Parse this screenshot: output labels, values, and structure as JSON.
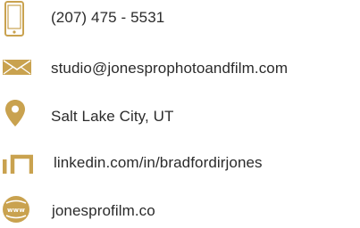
{
  "accent_color": "#c9a24f",
  "contacts": [
    {
      "icon": "phone-icon",
      "text": "(207) 475 - 5531"
    },
    {
      "icon": "email-icon",
      "text": "studio@jonesprophotoandfilm.com"
    },
    {
      "icon": "location-pin-icon",
      "text": "Salt Lake City, UT"
    },
    {
      "icon": "linkedin-icon",
      "text": "linkedin.com/in/bradfordirjones"
    },
    {
      "icon": "globe-www-icon",
      "text": "jonesprofilm.co"
    }
  ]
}
